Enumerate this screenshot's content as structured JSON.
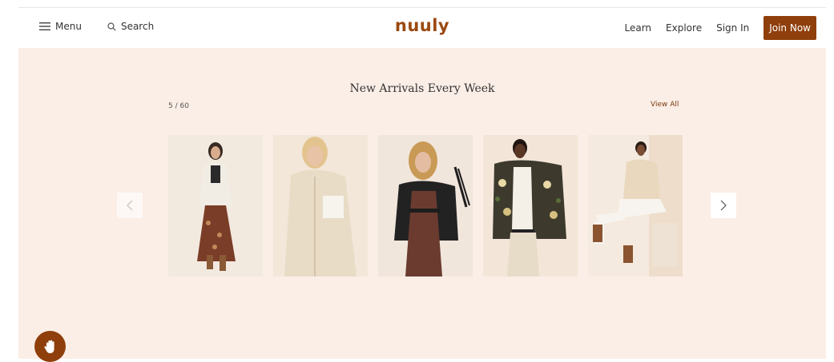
{
  "header": {
    "menu_label": "Menu",
    "search_label": "Search",
    "logo": "nuuly",
    "learn": "Learn",
    "explore": "Explore",
    "sign_in": "Sign In",
    "join_now": "Join Now"
  },
  "hero": {
    "headline": "New Arrivals Every Week",
    "counter": "5 / 60",
    "view_all": "View All"
  },
  "products": [
    {
      "name": "product-card-floral-skirt"
    },
    {
      "name": "product-card-sherpa-jacket"
    },
    {
      "name": "product-card-fringe-leather-jacket"
    },
    {
      "name": "product-card-print-blazer"
    },
    {
      "name": "product-card-cream-jacket"
    }
  ],
  "colors": {
    "brand": "#8f3f0c",
    "hero_bg": "#fbeee6"
  }
}
